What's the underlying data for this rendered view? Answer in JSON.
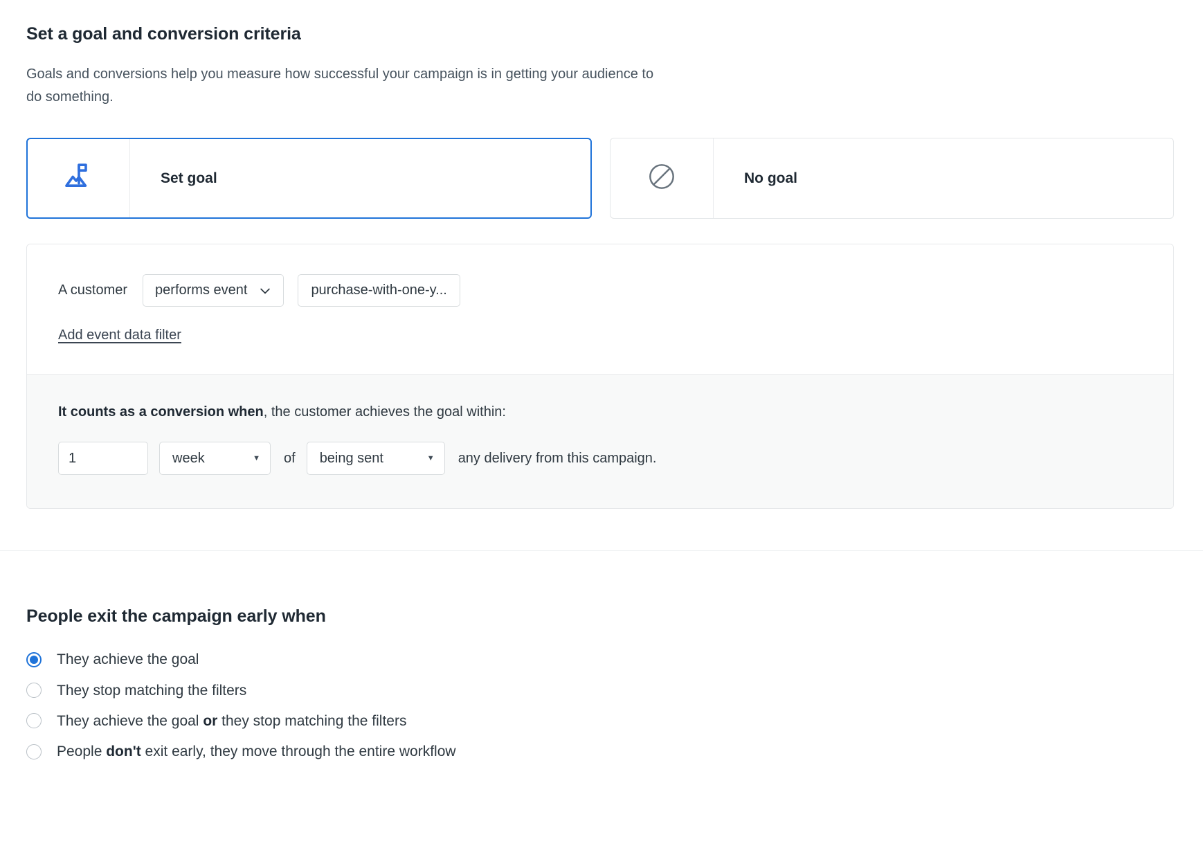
{
  "goal_section": {
    "title": "Set a goal and conversion criteria",
    "description": "Goals and conversions help you measure how successful your campaign is in getting your audience to do something.",
    "cards": [
      {
        "label": "Set goal",
        "icon": "mountain-flag-icon",
        "selected": true
      },
      {
        "label": "No goal",
        "icon": "no-entry-icon",
        "selected": false
      }
    ],
    "criteria": {
      "subject_label": "A customer",
      "condition_select": "performs event",
      "event_value": "purchase-with-one-y...",
      "add_filter_link": "Add event data filter",
      "conversion_prefix": "It counts as a conversion when",
      "conversion_rest": ", the customer achieves the goal within:",
      "amount": "1",
      "unit_select": "week",
      "of_word": "of",
      "anchor_select": "being sent",
      "trailing_text": "any delivery from this campaign."
    }
  },
  "exit_section": {
    "title": "People exit the campaign early when",
    "options": [
      {
        "prefix": "They achieve the goal",
        "strong": "",
        "suffix": "",
        "selected": true
      },
      {
        "prefix": "They stop matching the filters",
        "strong": "",
        "suffix": "",
        "selected": false
      },
      {
        "prefix": "They achieve the goal ",
        "strong": "or",
        "suffix": " they stop matching the filters",
        "selected": false
      },
      {
        "prefix": "People ",
        "strong": "don't",
        "suffix": " exit early, they move through the entire workflow",
        "selected": false
      }
    ]
  },
  "colors": {
    "accent_blue": "#1f73d9",
    "text_primary": "#2f3941",
    "border_grey": "#d8dcde",
    "panel_grey": "#f8f9f9"
  }
}
